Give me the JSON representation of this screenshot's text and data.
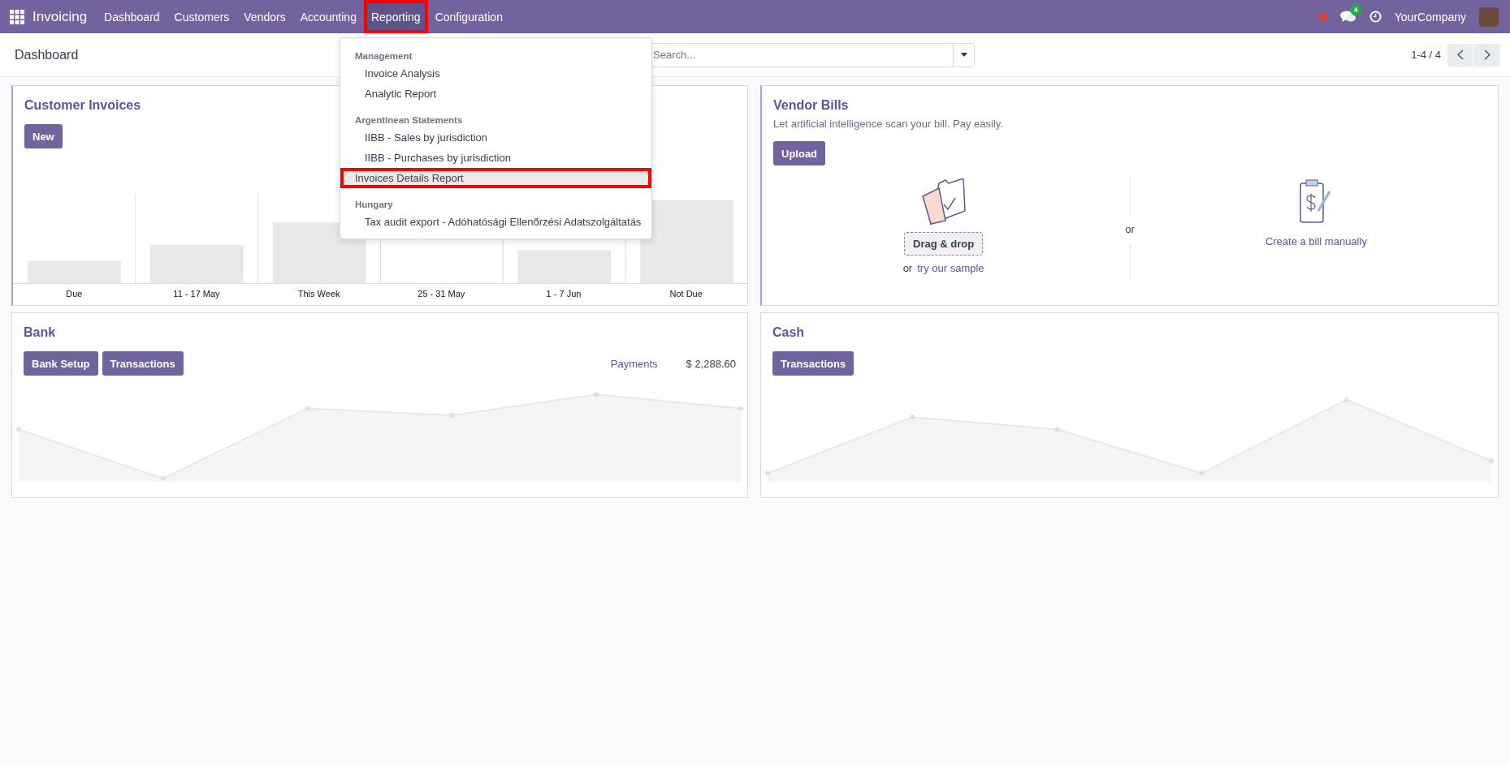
{
  "navbar": {
    "app_name": "Invoicing",
    "menu": [
      {
        "label": "Dashboard",
        "selected": false,
        "highlighted": false
      },
      {
        "label": "Customers",
        "selected": false,
        "highlighted": false
      },
      {
        "label": "Vendors",
        "selected": false,
        "highlighted": false
      },
      {
        "label": "Accounting",
        "selected": false,
        "highlighted": false
      },
      {
        "label": "Reporting",
        "selected": true,
        "highlighted": true
      },
      {
        "label": "Configuration",
        "selected": false,
        "highlighted": false
      }
    ],
    "messages_badge": "4",
    "company": "YourCompany"
  },
  "control_panel": {
    "breadcrumb": "Dashboard",
    "search": {
      "placeholder": "Search..."
    },
    "pager": "1-4 / 4"
  },
  "reporting_menu": {
    "entries": [
      {
        "kind": "section",
        "label": "Management",
        "children": [
          {
            "label": "Invoice Analysis",
            "hovered": false,
            "highlighted": false
          },
          {
            "label": "Analytic Report",
            "hovered": false,
            "highlighted": false
          }
        ]
      },
      {
        "kind": "section",
        "label": "Argentinean Statements",
        "children": [
          {
            "label": "IIBB - Sales by jurisdiction",
            "hovered": false,
            "highlighted": false
          },
          {
            "label": "IIBB - Purchases by jurisdiction",
            "hovered": false,
            "highlighted": false
          }
        ]
      },
      {
        "kind": "entry",
        "label": "Invoices Details Report",
        "hovered": true,
        "highlighted": true
      },
      {
        "kind": "section",
        "label": "Hungary",
        "children": [
          {
            "label": "Tax audit export - Adóhatósági Ellenőrzési Adatszolgáltatás",
            "hovered": false,
            "highlighted": false
          }
        ]
      }
    ]
  },
  "customer_invoices": {
    "title": "Customer Invoices",
    "button": "New",
    "chart_labels": [
      "Due",
      "11 - 17 May",
      "This Week",
      "25 - 31 May",
      "1 - 7 Jun",
      "Not Due"
    ]
  },
  "vendor_bills": {
    "title": "Vendor Bills",
    "subtitle": "Let artificial intelligence scan your bill. Pay easily.",
    "button": "Upload",
    "drop_zone": "Drag & drop",
    "or_text": "or",
    "sample_link": "try our sample",
    "divider_text": "or",
    "manual_link": "Create a bill manually"
  },
  "bank": {
    "title": "Bank",
    "buttons": [
      "Bank Setup",
      "Transactions"
    ],
    "payments_label": "Payments",
    "payments_amount": "$ 2,288.60"
  },
  "cash": {
    "title": "Cash",
    "buttons": [
      "Transactions"
    ]
  }
}
